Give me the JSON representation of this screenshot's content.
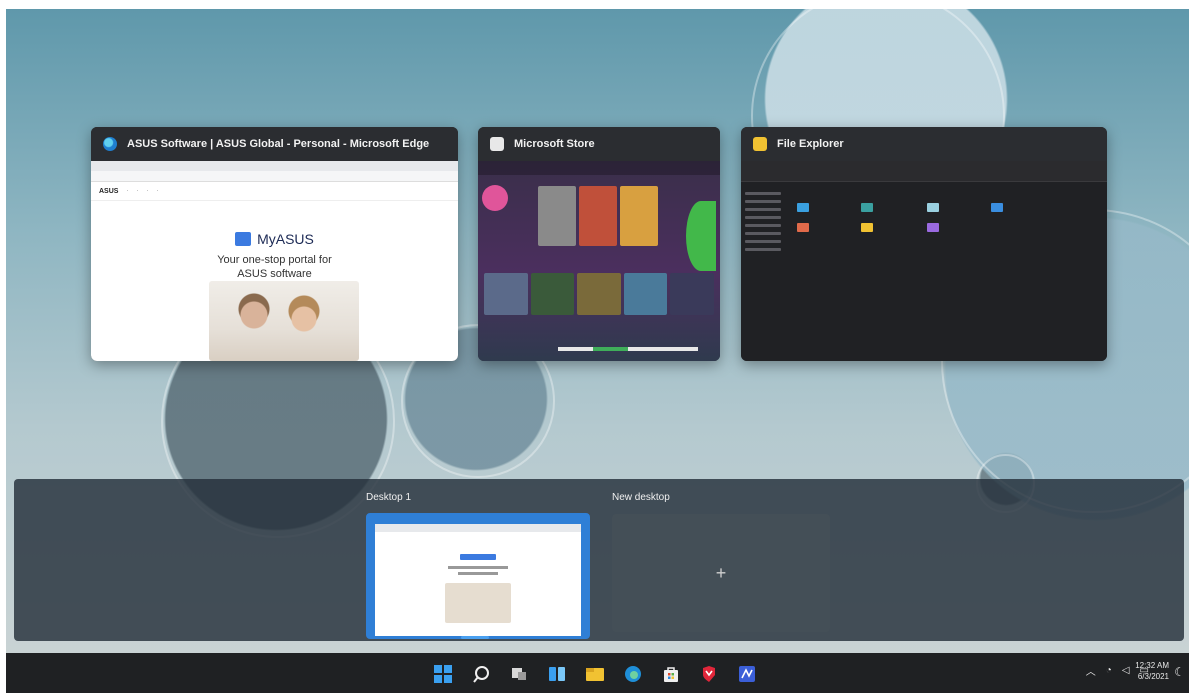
{
  "windows": [
    {
      "title": "ASUS Software | ASUS Global - Personal - Microsoft Edge",
      "icon": "edge-icon",
      "color": "#1fa0d8"
    },
    {
      "title": "Microsoft Store",
      "icon": "store-icon",
      "color": "#e8e8e8"
    },
    {
      "title": "File Explorer",
      "icon": "folder-icon",
      "color": "#f1c232"
    }
  ],
  "edge_page": {
    "brand": "MyASUS",
    "tagline_line1": "Your one-stop portal for",
    "tagline_line2": "ASUS software"
  },
  "desktops": {
    "current_label": "Desktop 1",
    "new_label": "New desktop",
    "new_symbol": "+"
  },
  "taskbar": {
    "icons": [
      "start-icon",
      "search-icon",
      "task-view-icon",
      "widgets-icon",
      "file-explorer-icon",
      "edge-icon",
      "store-icon",
      "mcafee-icon",
      "myasus-icon"
    ],
    "time": "12:32 AM",
    "date": "6/3/2021"
  },
  "colors": {
    "taskbar": "#1f2123",
    "accent": "#2f7fd6"
  }
}
